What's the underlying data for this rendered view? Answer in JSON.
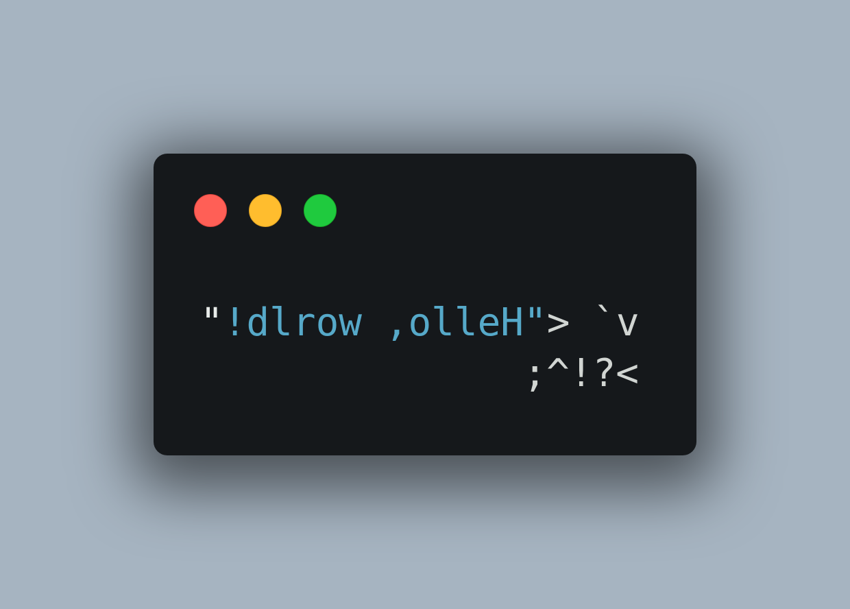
{
  "window": {
    "background": "#15181b",
    "traffic_lights": [
      {
        "name": "close",
        "color": "#ff5f56",
        "border": "#e0443e"
      },
      {
        "name": "minimize",
        "color": "#ffbd2e",
        "border": "#dea123"
      },
      {
        "name": "zoom",
        "color": "#1fca3e",
        "border": "#1aab29"
      }
    ]
  },
  "code": {
    "line1": {
      "quote_open": "\"",
      "string": "!dlrow ,olleH",
      "quote_close": "\"",
      "rest": "> `v"
    },
    "line2": {
      "text": ";^!?<"
    }
  },
  "colors": {
    "page_background": "#a6b4c1",
    "string": "#56a9c9",
    "text": "#d1d5d2"
  }
}
